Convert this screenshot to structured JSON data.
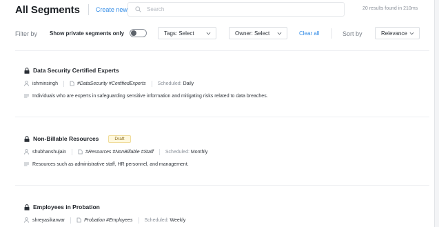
{
  "header": {
    "title": "All Segments",
    "create_label": "Create new",
    "search_placeholder": "Search",
    "results_text": "20 results found in 210ms"
  },
  "filters": {
    "filter_by_label": "Filter by",
    "private_toggle_label": "Show private segments only",
    "private_toggle_on": false,
    "tags_select": "Tags: Select",
    "owner_select": "Owner: Select",
    "clear_all_label": "Clear all",
    "sort_by_label": "Sort by",
    "sort_select": "Relevance"
  },
  "segments": [
    {
      "title": "Data Security Certified Experts",
      "badge": "",
      "owner": "ishminsingh",
      "tags": "#DataSecurity #CertifiedExperts",
      "scheduled_label": "Scheduled:",
      "scheduled_value": "Daily",
      "description": "Individuals who are experts in safeguarding sensitive information and mitigating risks related to data breaches."
    },
    {
      "title": "Non-Billable Resources",
      "badge": "Draft",
      "owner": "shubhanshujain",
      "tags": "#Resources #NonBillable #Staff",
      "scheduled_label": "Scheduled:",
      "scheduled_value": "Monthly",
      "description": "Resources such as administrative staff, HR personnel, and management."
    },
    {
      "title": "Employees in Probation",
      "badge": "",
      "owner": "shreyasikarwar",
      "tags": "Probation #Employees",
      "scheduled_label": "Scheduled:",
      "scheduled_value": "Weekly",
      "description": ""
    }
  ],
  "colors": {
    "accent": "#2f8ae6",
    "badge_bg": "#fff8dd"
  }
}
